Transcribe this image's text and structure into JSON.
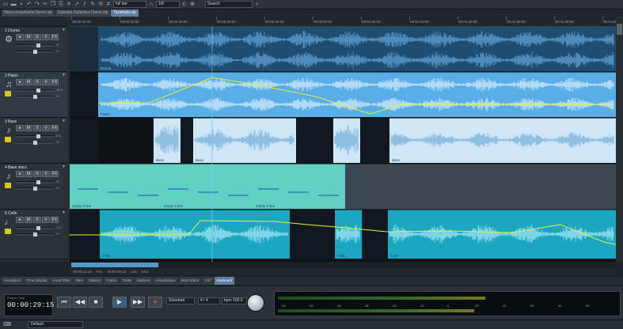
{
  "toolbar": {
    "mode_label": "full bar",
    "quantize_label": "1/8",
    "search_placeholder": "Search",
    "colors": {
      "accent": "#5c7fa3"
    }
  },
  "tabs": [
    {
      "label": "Neuro-loopmania Demo.vip",
      "active": false
    },
    {
      "label": "Dubstep Galactica Demo.vip",
      "active": false
    },
    {
      "label": "Taramula.vip",
      "active": true
    }
  ],
  "ruler_labels": [
    "00:00:00:00",
    "00:00:10:00",
    "00:00:20:00",
    "00:00:30:00",
    "00:00:40:00",
    "00:00:50:00",
    "00:01:00:00",
    "00:01:10:00",
    "00:01:20:00",
    "00:01:30:00",
    "00:01:40:00",
    "00:01:50:00"
  ],
  "tracks": [
    {
      "num": "1",
      "name": "Drums",
      "icon": "drum-icon",
      "vol": "+0",
      "pan": "+0"
    },
    {
      "num": "2",
      "name": "Piano",
      "icon": "piano-icon",
      "vol": "-10.0",
      "pan": "+0"
    },
    {
      "num": "3",
      "name": "Bass",
      "icon": "guitar-icon",
      "vol": "-5.4",
      "pan": "+0"
    },
    {
      "num": "4",
      "name": "Bass vlacc",
      "icon": "guitar-icon",
      "vol": "+0",
      "pan": "+0"
    },
    {
      "num": "5",
      "name": "Cello",
      "icon": "cello-icon",
      "vol": "-3.4",
      "pan": "+0"
    }
  ],
  "track_buttons": {
    "mute": "M",
    "solo": "S",
    "fx": "FX"
  },
  "clip_labels": {
    "drums": "Drums",
    "piano": "Piano",
    "bass1": "Bass",
    "bass2": "Bass",
    "bass3": "Bass",
    "empty1": "empty 8 Bar",
    "empty2": "empty 8 Bar",
    "empty3": "empty 8 Bar",
    "cello1": "Cello",
    "cello2": "Cello",
    "cello3": "Cello"
  },
  "position": {
    "marker": "00:00:13:16",
    "pos_label": "Pos",
    "pos_value": "00:00:29:15",
    "len_label": "Len",
    "end_label": "End"
  },
  "lower_tabs": [
    {
      "label": "Soundpool",
      "active": false
    },
    {
      "label": "Time Display",
      "active": false
    },
    {
      "label": "Vocal Filter",
      "active": false
    },
    {
      "label": "Files",
      "active": false
    },
    {
      "label": "Objects",
      "active": false
    },
    {
      "label": "Tracks",
      "active": false
    },
    {
      "label": "Tasks",
      "active": false
    },
    {
      "label": "Markers",
      "active": false
    },
    {
      "label": "Visualization",
      "active": false
    },
    {
      "label": "MIDI Editor",
      "active": false
    },
    {
      "label": "VST",
      "active": false
    },
    {
      "label": "Keyboard",
      "active": true
    }
  ],
  "transport": {
    "time": "00:00:29:15",
    "counter_top": "Project Time",
    "mode": "Standard",
    "tempo": "bpm 100.0",
    "meter": "4 / 4",
    "preset": "Default",
    "meter_marks": [
      "-60",
      "-50",
      "-40",
      "-30",
      "-20",
      "-10",
      "0",
      "10",
      "20",
      "30",
      "40",
      "50"
    ]
  }
}
